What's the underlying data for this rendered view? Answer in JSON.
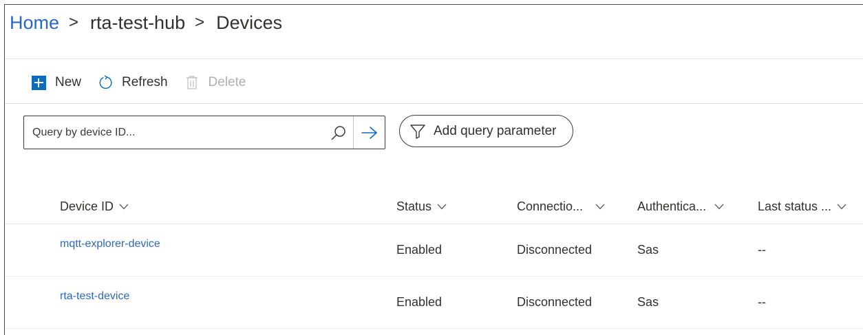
{
  "breadcrumb": {
    "home": "Home",
    "separator": ">",
    "hub": "rta-test-hub",
    "current": "Devices"
  },
  "toolbar": {
    "new_label": "New",
    "refresh_label": "Refresh",
    "delete_label": "Delete"
  },
  "search": {
    "placeholder": "Query by device ID...",
    "value": ""
  },
  "filter": {
    "add_query_label": "Add query parameter"
  },
  "table": {
    "columns": [
      {
        "label": "Device ID"
      },
      {
        "label": "Status"
      },
      {
        "label": "Connectio..."
      },
      {
        "label": "Authentica..."
      },
      {
        "label": "Last status ..."
      }
    ],
    "rows": [
      {
        "device_id": "mqtt-explorer-device",
        "status": "Enabled",
        "connection": "Disconnected",
        "auth": "Sas",
        "last_status": "--"
      },
      {
        "device_id": "rta-test-device",
        "status": "Enabled",
        "connection": "Disconnected",
        "auth": "Sas",
        "last_status": "--"
      }
    ]
  },
  "colors": {
    "accent": "#0f6cbd",
    "link": "#2b67c6",
    "text": "#323130",
    "disabled": "#b3b0ad"
  },
  "icons": {
    "new": "plus-square-icon",
    "refresh": "refresh-icon",
    "delete": "trash-icon",
    "search": "search-icon",
    "submit": "arrow-right-icon",
    "filter": "filter-icon",
    "sort": "chevron-down-icon"
  }
}
